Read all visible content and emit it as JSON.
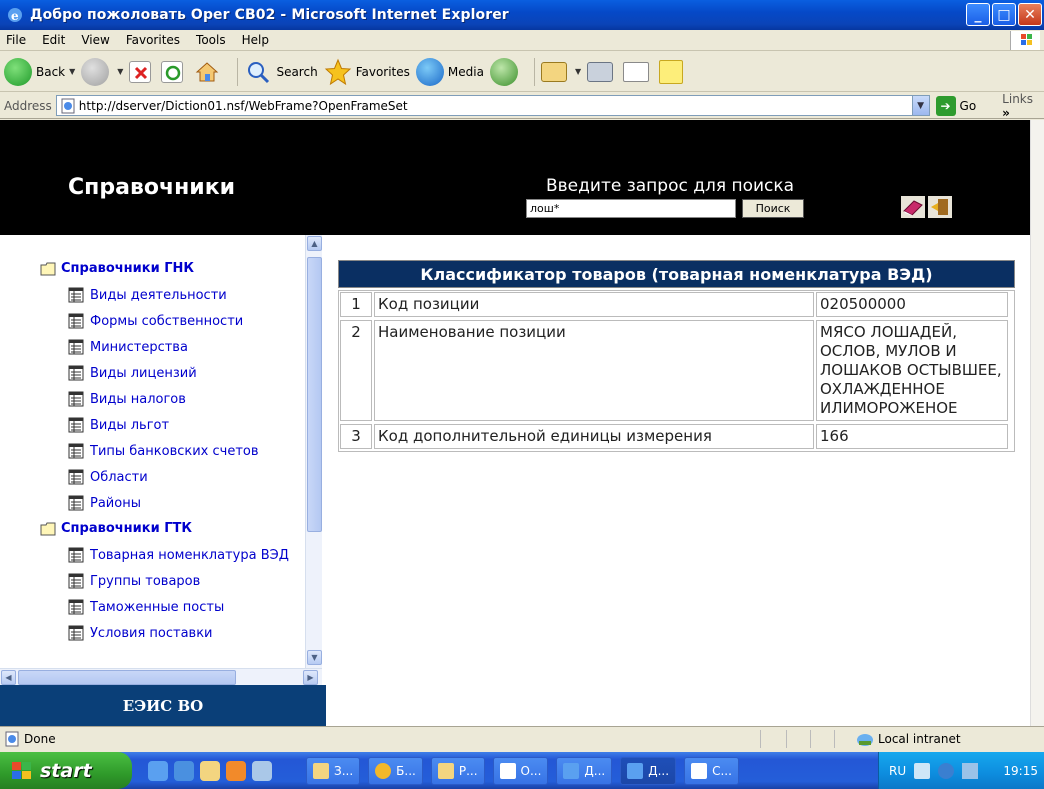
{
  "window": {
    "title": "Добро пожоловать Oper CB02 - Microsoft Internet Explorer",
    "minimize": "_",
    "maximize": "□",
    "close": "✕"
  },
  "menu": [
    "File",
    "Edit",
    "View",
    "Favorites",
    "Tools",
    "Help"
  ],
  "toolbar": {
    "back": "Back",
    "search": "Search",
    "favorites": "Favorites",
    "media": "Media"
  },
  "address": {
    "label": "Address",
    "url": "http://dserver/Diction01.nsf/WebFrame?OpenFrameSet",
    "go": "Go",
    "links": "Links"
  },
  "header": {
    "brand": "Справочники",
    "prompt": "Введите запрос для поиска",
    "search_value": "лош*",
    "search_button": "Поиск"
  },
  "nav": {
    "groups": [
      {
        "label": "Справочники ГНК",
        "items": [
          "Виды деятельности",
          "Формы собственности",
          "Министерства",
          "Виды лицензий",
          "Виды налогов",
          "Виды льгот",
          "Типы банковских счетов",
          "Области",
          "Районы"
        ]
      },
      {
        "label": "Справочники ГТК",
        "items": [
          "Товарная номенклатура ВЭД",
          "Группы товаров",
          "Таможенные посты",
          "Условия поставки"
        ]
      }
    ],
    "footer": "ЕЭИС ВО"
  },
  "content": {
    "title": "Классификатор товаров (товарная номенклатура ВЭД)",
    "rows": [
      {
        "num": "1",
        "name": "Код позиции",
        "value": "020500000"
      },
      {
        "num": "2",
        "name": "Наименование позиции",
        "value": "МЯСО ЛОШАДЕЙ, ОСЛОВ, МУЛОВ И ЛОШАКОВ ОСТЫВШЕЕ, ОХЛАЖДЕННОЕ ИЛИМОРОЖЕНОЕ"
      },
      {
        "num": "3",
        "name": "Код дополнительной единицы измерения",
        "value": "166"
      }
    ]
  },
  "status": {
    "text": "Done",
    "zone": "Local intranet"
  },
  "taskbar": {
    "start": "start",
    "tasks": [
      "З...",
      "Б...",
      "Р...",
      "О...",
      "Д...",
      "Д...",
      "С..."
    ],
    "lang": "RU",
    "clock": "19:15"
  },
  "colors": {
    "header_bg": "#000000",
    "table_header_bg": "#0a2f62",
    "nav_link": "#0000cc",
    "footer_bg": "#0a3f78"
  }
}
